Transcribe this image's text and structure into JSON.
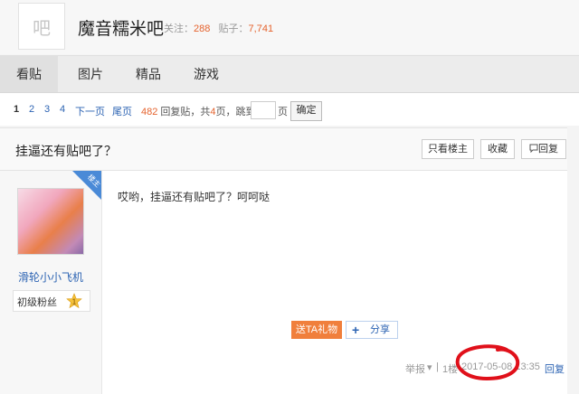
{
  "forum": {
    "logo_char": "吧",
    "name": "魔音糯米吧",
    "follow_label": "关注：",
    "follow_count": "288",
    "posts_label": "贴子：",
    "posts_count": "7,741"
  },
  "tabs": [
    "看贴",
    "图片",
    "精品",
    "游戏"
  ],
  "pager": {
    "pages": [
      "1",
      "2",
      "3",
      "4"
    ],
    "next": "下一页",
    "last": "尾页",
    "reply_count": "482",
    "reply_label": "回复贴，共",
    "total_pages": "4",
    "pages_label": "页，跳到",
    "page_suffix": "页",
    "confirm": "确定"
  },
  "thread": {
    "title": "挂逼还有贴吧了？",
    "only_op": "只看楼主",
    "favorite": "收藏",
    "reply": "回复"
  },
  "post": {
    "author": "滑轮小小飞机",
    "fan_level": "初级粉丝",
    "level_num": "1",
    "op_badge": "楼主",
    "content": "哎哟，挂逼还有贴吧了？呵呵哒",
    "gift": "送TA礼物",
    "share": "分享",
    "report": "举报",
    "floor": "1楼",
    "time": "2017-05-08 13:35",
    "reply": "回复"
  },
  "colors": {
    "accent_orange": "#e5632e",
    "link_blue": "#2d64b3",
    "gift_orange": "#f07f3c",
    "annotation_red": "#e0101a"
  }
}
